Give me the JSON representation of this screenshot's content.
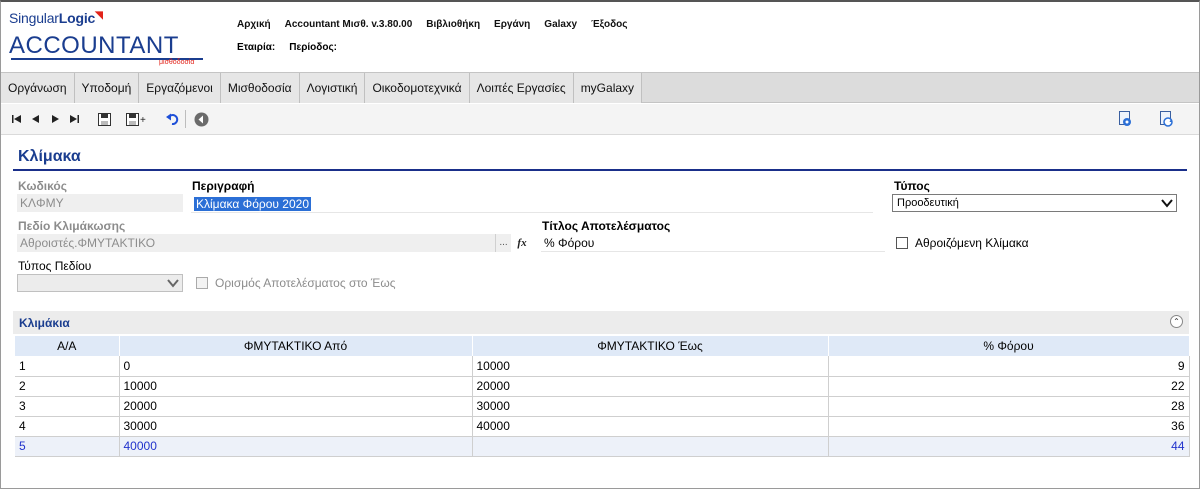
{
  "header": {
    "logo_company": "Singular",
    "logo_company_bold": "Logic",
    "logo_product": "ACCOUNTANT",
    "logo_sub": "μισθοδοσία",
    "menu": [
      "Αρχική",
      "Accountant Μισθ. v.3.80.00",
      "Βιβλιοθήκη",
      "Εργάνη",
      "Galaxy",
      "Έξοδος"
    ],
    "company_label": "Εταιρία:",
    "period_label": "Περίοδος:"
  },
  "tabs": [
    "Οργάνωση",
    "Υποδομή",
    "Εργαζόμενοι",
    "Μισθοδοσία",
    "Λογιστική",
    "Οικοδομοτεχνικά",
    "Λοιπές Εργασίες",
    "myGalaxy"
  ],
  "form": {
    "title": "Κλίμακα",
    "code_label": "Κωδικός",
    "code_value": "ΚΛΦΜΥ",
    "description_label": "Περιγραφή",
    "description_value": "Κλίμακα Φόρου 2020",
    "type_label": "Τύπος",
    "type_value": "Προοδευτική",
    "scale_field_label": "Πεδίο Κλιμάκωσης",
    "scale_field_value": "Αθροιστές.ΦΜΥΤΑΚΤΙΚΟ",
    "scale_field_button": "...",
    "fx_button": "fx",
    "result_title_label": "Τίτλος Αποτελέσματος",
    "result_title_value": "% Φόρου",
    "cumulative_label": "Αθροιζόμενη Κλίμακα",
    "field_type_label": "Τύπος Πεδίου",
    "field_type_value": "",
    "result_def_label": "Ορισμός Αποτελέσματος στο Έως"
  },
  "grid": {
    "section_title": "Κλιμάκια",
    "columns": [
      "Α/Α",
      "ΦΜΥΤΑΚΤΙΚΟ Από",
      "ΦΜΥΤΑΚΤΙΚΟ Έως",
      "% Φόρου"
    ],
    "rows": [
      [
        "1",
        "0",
        "10000",
        "9"
      ],
      [
        "2",
        "10000",
        "20000",
        "22"
      ],
      [
        "3",
        "20000",
        "30000",
        "28"
      ],
      [
        "4",
        "30000",
        "40000",
        "36"
      ],
      [
        "5",
        "40000",
        "",
        "44"
      ]
    ],
    "active_row": 4
  },
  "colors": {
    "brand": "#1a3d8f",
    "accent_red": "#e2231a",
    "selection": "#2b6fd6",
    "grid_header": "#dfe9f7"
  }
}
